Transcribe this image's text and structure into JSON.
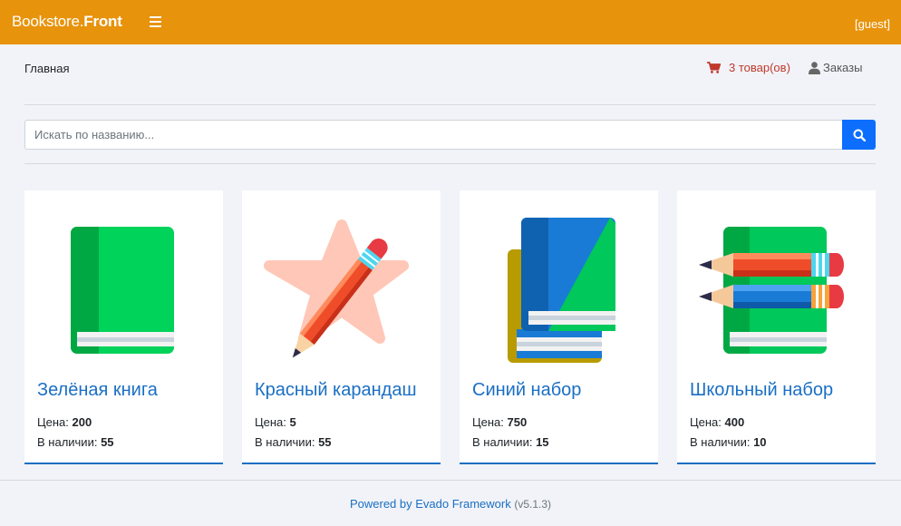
{
  "header": {
    "brand_light": "Bookstore.",
    "brand_bold": "Front",
    "user": "[guest]"
  },
  "nav": {
    "breadcrumb": "Главная",
    "cart_label": "3 товар(ов)",
    "orders_label": "Заказы"
  },
  "search": {
    "placeholder": "Искать по названию..."
  },
  "products": [
    {
      "title": "Зелёная книга",
      "price_label": "Цена: ",
      "price": "200",
      "stock_label": "В наличии: ",
      "stock": "55",
      "icon": "green-book-icon"
    },
    {
      "title": "Красный карандаш",
      "price_label": "Цена: ",
      "price": "5",
      "stock_label": "В наличии: ",
      "stock": "55",
      "icon": "red-pencil-icon"
    },
    {
      "title": "Синий набор",
      "price_label": "Цена: ",
      "price": "750",
      "stock_label": "В наличии: ",
      "stock": "15",
      "icon": "blue-book-set-icon"
    },
    {
      "title": "Школьный набор",
      "price_label": "Цена: ",
      "price": "400",
      "stock_label": "В наличии: ",
      "stock": "10",
      "icon": "school-set-icon"
    }
  ],
  "footer": {
    "link": "Powered by Evado Framework",
    "version": "(v5.1.3)"
  },
  "colors": {
    "topbar": "#e8930c",
    "link": "#1a6fc4",
    "cart": "#c0392b",
    "search_button": "#0d6efd"
  }
}
